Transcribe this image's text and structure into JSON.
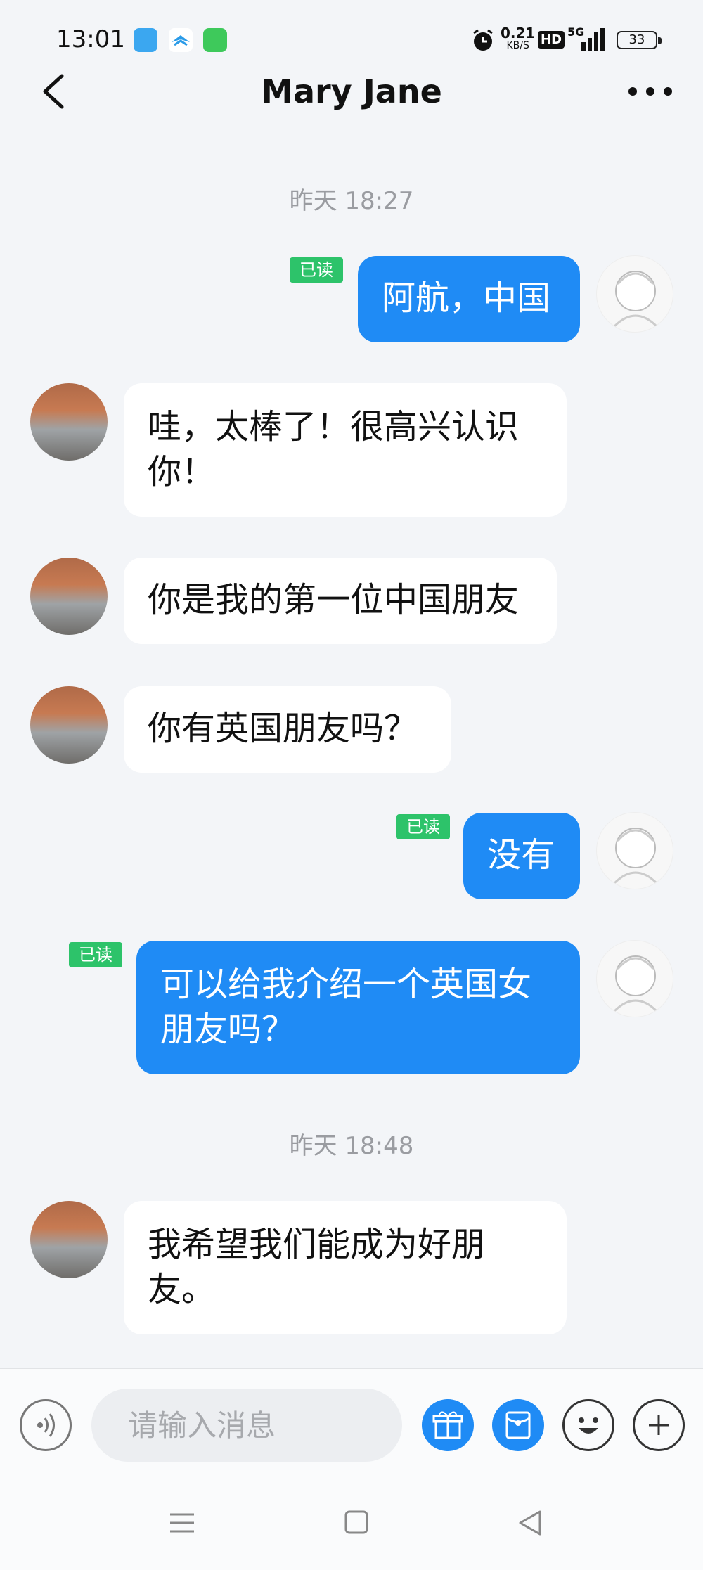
{
  "status_bar": {
    "time": "13:01",
    "net_speed_value": "0.21",
    "net_speed_unit": "KB/S",
    "hd_label": "HD",
    "network_label": "5G",
    "battery": "33",
    "icons": [
      "notification-app-icon",
      "cloud-app-icon",
      "message-app-icon",
      "alarm-icon",
      "signal-icon",
      "battery-icon"
    ]
  },
  "header": {
    "title": "Mary Jane"
  },
  "chat": {
    "timestamps": [
      "昨天 18:27",
      "昨天 18:48"
    ],
    "read_label": "已读",
    "messages": [
      {
        "side": "out",
        "text": "阿航，中国",
        "read": true
      },
      {
        "side": "in",
        "text": "哇，太棒了！很高兴认识你！"
      },
      {
        "side": "in",
        "text": "你是我的第一位中国朋友"
      },
      {
        "side": "in",
        "text": "你有英国朋友吗？"
      },
      {
        "side": "out",
        "text": "没有",
        "read": true
      },
      {
        "side": "out",
        "text": "可以给我介绍一个英国女朋友吗？",
        "read": true
      },
      {
        "side": "in",
        "text": "我希望我们能成为好朋友。"
      }
    ]
  },
  "input_bar": {
    "placeholder": "请输入消息"
  },
  "colors": {
    "outgoing_bubble": "#1f8bf5",
    "read_badge": "#2dc36a",
    "background": "#f3f5f8"
  }
}
